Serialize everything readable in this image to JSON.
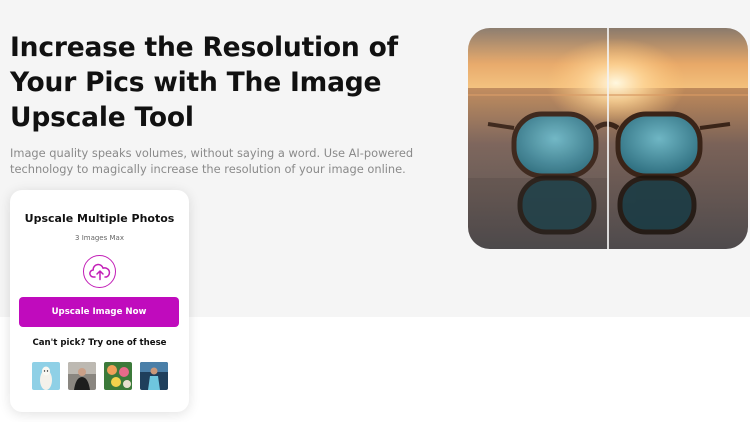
{
  "hero": {
    "title": "Increase the Resolution of Your Pics with The Image Upscale Tool",
    "subtitle": "Image quality speaks volumes, without saying a word. Use AI-powered technology to magically increase the resolution of your image online."
  },
  "upload_card": {
    "title": "Upscale Multiple Photos",
    "limit": "3 Images Max",
    "upload_icon": "cloud-upload-icon",
    "button_label": "Upscale Image Now",
    "samples_prompt": "Can't pick? Try one of these"
  },
  "colors": {
    "accent": "#c00bbd",
    "hero_background": "#f5f5f5"
  }
}
